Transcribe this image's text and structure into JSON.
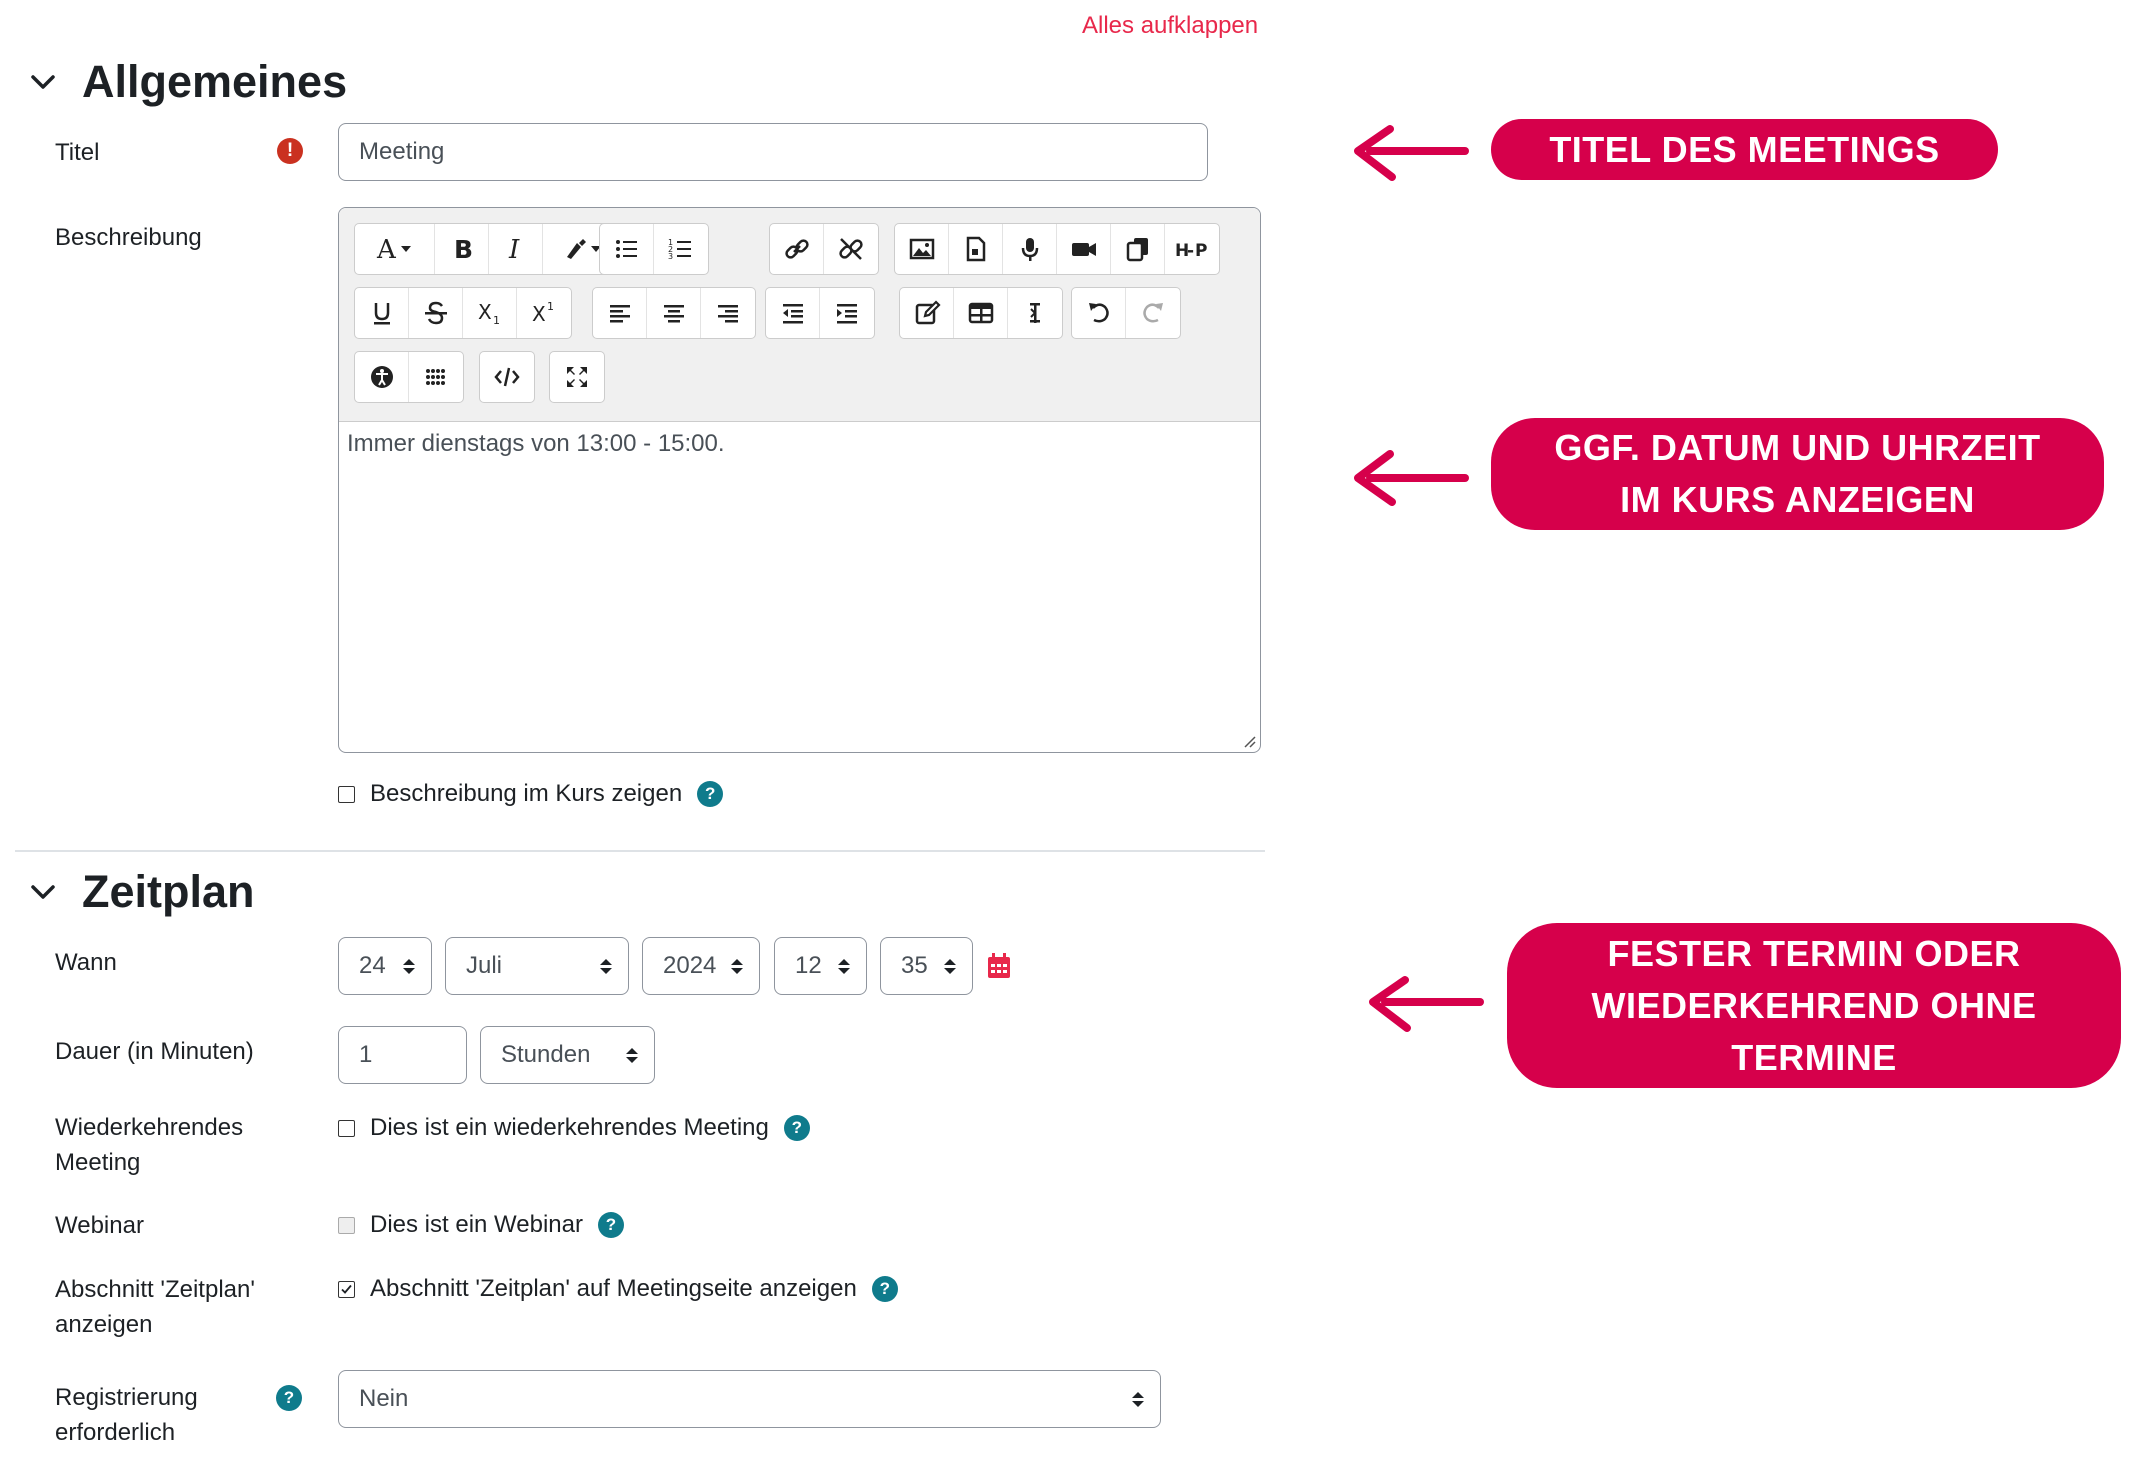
{
  "expand_all": "Alles aufklappen",
  "general": {
    "title": "Allgemeines",
    "titel_label": "Titel",
    "titel_value": "Meeting",
    "beschreibung_label": "Beschreibung",
    "editor_content": "Immer dienstags von 13:00 - 15:00.",
    "show_description_label": "Beschreibung im Kurs zeigen"
  },
  "schedule": {
    "title": "Zeitplan",
    "wann_label": "Wann",
    "day": "24",
    "month": "Juli",
    "year": "2024",
    "hour": "12",
    "minute": "35",
    "dauer_label": "Dauer (in Minuten)",
    "duration_value": "1",
    "duration_unit": "Stunden",
    "recurring_label_1": "Wiederkehrendes",
    "recurring_label_2": "Meeting",
    "recurring_checkbox": "Dies ist ein wiederkehrendes Meeting",
    "webinar_label": "Webinar",
    "webinar_checkbox": "Dies ist ein Webinar",
    "show_schedule_label_1": "Abschnitt 'Zeitplan'",
    "show_schedule_label_2": "anzeigen",
    "show_schedule_checkbox": "Abschnitt 'Zeitplan' auf Meetingseite anzeigen",
    "registration_label_1": "Registrierung",
    "registration_label_2": "erforderlich",
    "registration_value": "Nein"
  },
  "callouts": {
    "c1": "TITEL DES MEETINGS",
    "c2_line1": "GGF. DATUM UND UHRZEIT",
    "c2_line2": "IM KURS ANZEIGEN",
    "c3_line1": "FESTER TERMIN ODER",
    "c3_line2": "WIEDERKEHREND OHNE",
    "c3_line3": "TERMINE"
  },
  "colors": {
    "accent": "#d6004b",
    "link": "#e8284b",
    "help": "#0f7b8c",
    "required": "#ca3120"
  }
}
